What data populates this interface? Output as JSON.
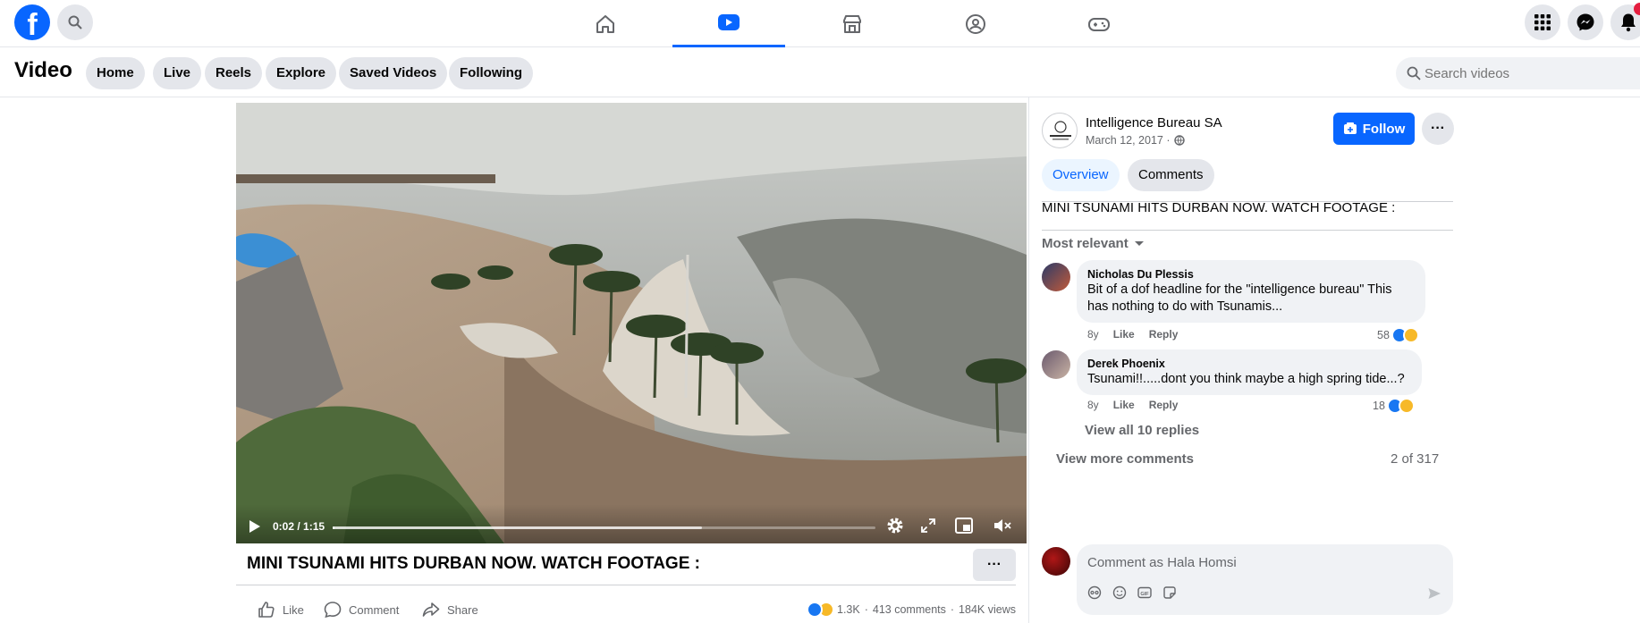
{
  "nav": {
    "logo_letter": "f",
    "tabs": [
      {
        "icon": "home-icon"
      },
      {
        "icon": "video-icon",
        "active": true
      },
      {
        "icon": "marketplace-icon"
      },
      {
        "icon": "groups-icon"
      },
      {
        "icon": "gaming-icon"
      }
    ]
  },
  "subnav": {
    "title": "Video",
    "pills": [
      "Home",
      "Live",
      "Reels",
      "Explore",
      "Saved Videos",
      "Following"
    ],
    "search_placeholder": "Search videos"
  },
  "player": {
    "time": "0:02 / 1:15",
    "progress": 0.004,
    "buffered": 0.68
  },
  "video": {
    "title": "MINI TSUNAMI HITS DURBAN NOW. WATCH FOOTAGE :",
    "actions": [
      "Like",
      "Comment",
      "Share"
    ],
    "reaction_count": "1.3K",
    "comments_count": "413 comments",
    "views": "184K views",
    "separator": "·"
  },
  "page": {
    "name": "Intelligence Bureau SA",
    "date": "March 12, 2017 ·",
    "follow_label": "Follow",
    "tabs": [
      "Overview",
      "Comments"
    ],
    "description": "MINI TSUNAMI HITS DURBAN NOW. WATCH FOOTAGE :",
    "sort_label": "Most relevant"
  },
  "comments": [
    {
      "author": "Nicholas Du Plessis",
      "text_line1": "Bit of a dof headline for the \"intelligence bureau\" This",
      "text_line2": "has nothing to do with Tsunamis...",
      "age": "8y",
      "like": "Like",
      "reply": "Reply",
      "reactions": "58"
    },
    {
      "author": "Derek Phoenix",
      "text_line1": "Tsunami!!.....dont you think maybe a high spring tide...?",
      "age": "8y",
      "like": "Like",
      "reply": "Reply",
      "reactions": "18",
      "replies_link": "View all 10 replies"
    }
  ],
  "comments_footer": {
    "more_label": "View more comments",
    "count": "2 of 317"
  },
  "composer": {
    "placeholder": "Comment as Hala Homsi"
  },
  "colors": {
    "accent": "#0866ff",
    "pill_bg": "#e4e6eb",
    "bubble_bg": "#f0f2f5"
  }
}
